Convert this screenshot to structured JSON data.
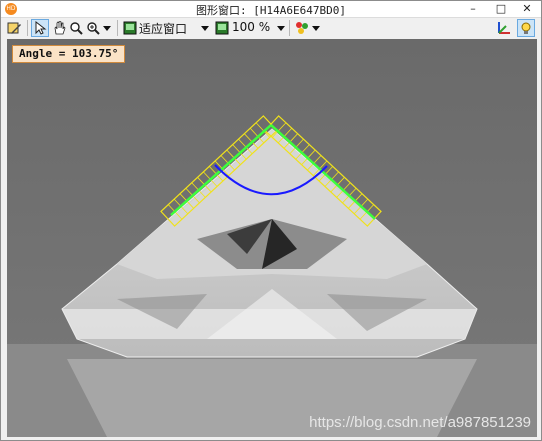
{
  "window": {
    "title": "图形窗口: [H14A6E647BD0]",
    "app_icon_text": "HD",
    "controls": {
      "minimize": "–",
      "maximize": "□",
      "close": "✕"
    }
  },
  "toolbar": {
    "zoom_fit_label": "适应窗口",
    "zoom_percent_label": "100 %",
    "icons": [
      "pencil-icon",
      "pointer-icon",
      "hand-icon",
      "magnifier-icon",
      "zoom-icon",
      "fit-window-icon",
      "zoom-percent-icon",
      "color-palette-icon",
      "axes-icon",
      "lightbulb-icon"
    ]
  },
  "overlay": {
    "angle_text": "Angle = 103.75°"
  },
  "watermark": "https://blog.csdn.net/a987851239",
  "colors": {
    "measure_box": "#f0e21a",
    "edge_line": "#3cff3c",
    "angle_arc": "#1a1aff",
    "background": "#6e6e6e"
  }
}
